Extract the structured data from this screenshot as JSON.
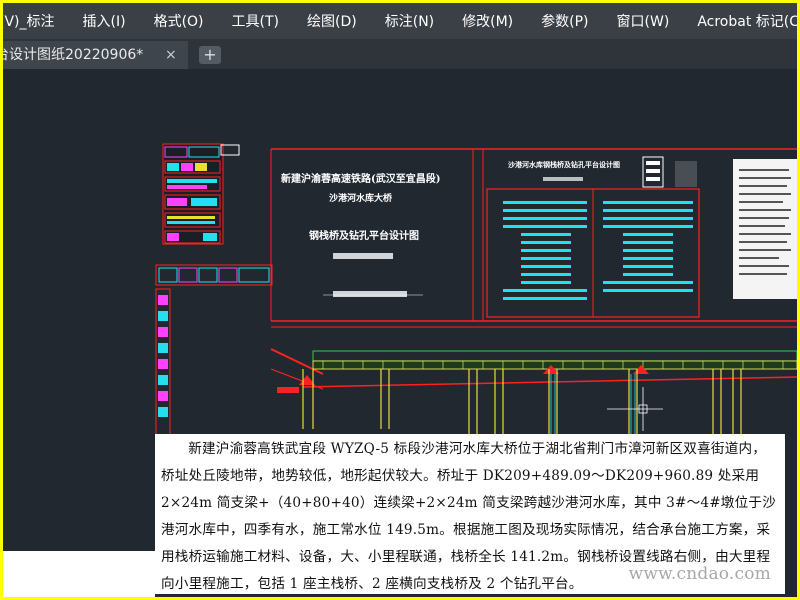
{
  "menu": {
    "items": [
      "(V)_标注",
      "插入(I)",
      "格式(O)",
      "工具(T)",
      "绘图(D)",
      "标注(N)",
      "修改(M)",
      "参数(P)",
      "窗口(W)",
      "Acrobat 标记(C)"
    ]
  },
  "tabs": {
    "active_label": "台设计图纸20220906*",
    "close_glyph": "×",
    "new_glyph": "+"
  },
  "drawing": {
    "title_line1": "新建沪渝蓉高速铁路(武汉至宜昌段)",
    "title_line2": "沙港河水库大桥",
    "title_line3": "钢栈桥及钻孔平台设计图",
    "table_title": "沙港河水库钢栈桥及钻孔平台设计图",
    "colors": {
      "red": "#ff2020",
      "cyan": "#23e0ee",
      "yellow": "#e8e030",
      "magenta": "#ff40ff",
      "green": "#30d040"
    }
  },
  "article": {
    "text": "新建沪渝蓉高铁武宜段 WYZQ-5 标段沙港河水库大桥位于湖北省荆门市漳河新区双喜街道内，桥址处丘陵地带，地势较低，地形起伏较大。桥址于 DK209+489.09～DK209+960.89 处采用 2×24m 简支梁+（40+80+40）连续梁+2×24m 简支梁跨越沙港河水库，其中 3#～4#墩位于沙港河水库中，四季有水，施工常水位 149.5m。根据施工图及现场实际情况，结合承台施工方案，采用栈桥运输施工材料、设备，大、小里程联通，栈桥全长 141.2m。钢栈桥设置线路右侧，由大里程向小里程施工，包括 1 座主栈桥、2 座横向支栈桥及 2 个钻孔平台。",
    "watermark": "www.cndao.com"
  }
}
